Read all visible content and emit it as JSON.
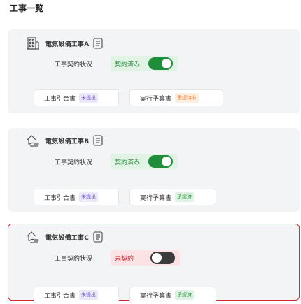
{
  "page_title": "工事一覧",
  "colors": {
    "accent_green": "#1f8d3a",
    "alert_red": "#cc2a33",
    "badge_purple": "#7b5cd6",
    "badge_orange": "#f07b32"
  },
  "projects": [
    {
      "name": "電気設備工事A",
      "icon": "building-icon",
      "contract_label": "工事契約状況",
      "contract_status": "契約済み",
      "contract_on": true,
      "docs": [
        {
          "label": "工事引合書",
          "badge": "未提出"
        },
        {
          "label": "実行予算書",
          "badge": "承認待ち"
        }
      ]
    },
    {
      "name": "電気設備工事B",
      "icon": "house-hand-icon",
      "contract_label": "工事契約状況",
      "contract_status": "契約済み",
      "contract_on": true,
      "docs": [
        {
          "label": "工事引合書",
          "badge": "未提出"
        },
        {
          "label": "実行予算書",
          "badge": "承認済"
        }
      ]
    },
    {
      "name": "電気設備工事C",
      "icon": "house-hand-icon",
      "contract_label": "工事契約状況",
      "contract_status": "未契約",
      "contract_on": false,
      "docs": [
        {
          "label": "工事引合書",
          "badge": "未提出"
        },
        {
          "label": "実行予算書",
          "badge": "承認済"
        }
      ]
    }
  ]
}
